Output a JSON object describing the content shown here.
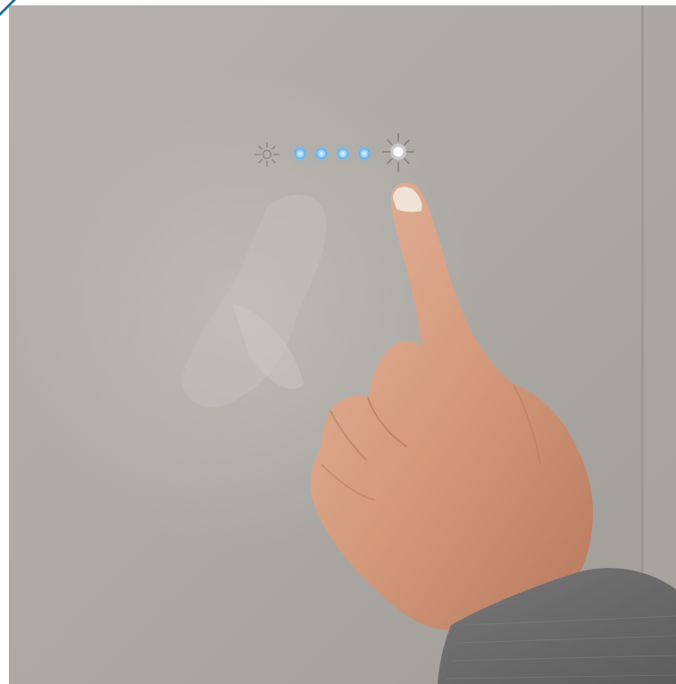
{
  "scene": {
    "subject": "brightness-touch-control",
    "colors": {
      "panel": "#a9a5a1",
      "panel_light": "#b9b6b2",
      "panel_edge": "#9e9a96",
      "frame": "#ffffff",
      "corner_accent": "#1f6e96",
      "indicator_blue": "#5ab4f0",
      "sun_glow": "#ffffff",
      "skin": "#d9a283",
      "skin_shadow": "#b9785c",
      "sleeve": "#6c6c6c"
    },
    "controls": {
      "icons": [
        "sun-dim-icon",
        "sun-bright-icon"
      ],
      "level_indicators": [
        {
          "name": "level-1",
          "state": "on"
        },
        {
          "name": "level-2",
          "state": "on"
        },
        {
          "name": "level-3",
          "state": "on"
        },
        {
          "name": "level-4",
          "state": "on"
        }
      ],
      "active_setting": "max-brightness"
    }
  }
}
